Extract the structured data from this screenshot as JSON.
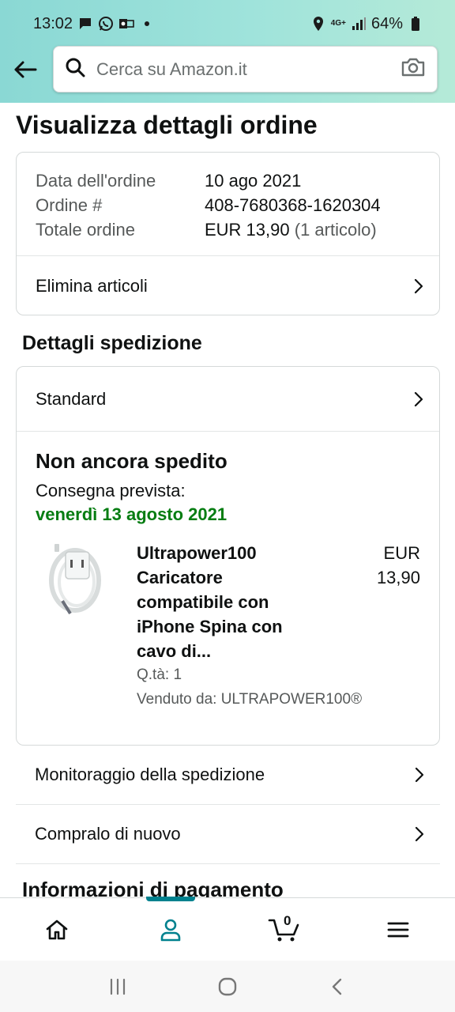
{
  "status_bar": {
    "time": "13:02",
    "network": "4G+",
    "battery": "64%"
  },
  "search": {
    "placeholder": "Cerca su Amazon.it"
  },
  "page": {
    "title": "Visualizza dettagli ordine"
  },
  "order": {
    "date_label": "Data dell'ordine",
    "date_value": "10 ago 2021",
    "number_label": "Ordine #",
    "number_value": "408-7680368-1620304",
    "total_label": "Totale ordine",
    "total_value": "EUR 13,90",
    "total_items": "(1 articolo)",
    "delete_items_label": "Elimina articoli"
  },
  "shipping": {
    "section_title": "Dettagli spedizione",
    "method": "Standard",
    "status": "Non ancora spedito",
    "delivery_label": "Consegna prevista:",
    "delivery_date": "venerdì 13 agosto 2021",
    "delivery_date_color": "#067d12",
    "product": {
      "title": "Ultrapower100 Caricatore compatibile con iPhone Spina con cavo di...",
      "price": "EUR 13,90",
      "quantity": "Q.tà: 1",
      "seller": "Venduto da: ULTRAPOWER100®"
    }
  },
  "actions": {
    "track_label": "Monitoraggio della spedizione",
    "buy_again_label": "Compralo di nuovo"
  },
  "payment": {
    "section_title": "Informazioni di pagamento"
  },
  "bottom_nav": {
    "items": [
      "home-icon",
      "account-icon",
      "cart-icon",
      "menu-icon"
    ],
    "cart_count": "0",
    "active_color": "#00818e"
  },
  "colors": {
    "header_gradient_start": "#8ad8d4",
    "header_gradient_end": "#b5ead8",
    "border": "#d5d9d9"
  }
}
